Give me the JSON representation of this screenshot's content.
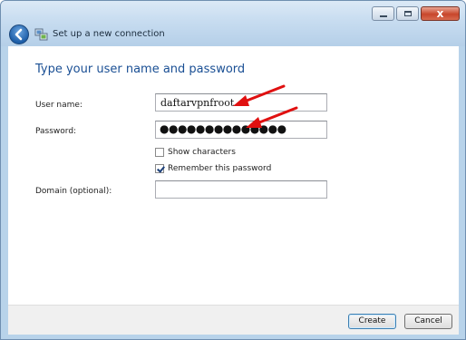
{
  "window": {
    "title": "Set up a new connection",
    "close_glyph": "x"
  },
  "main": {
    "heading": "Type your user name and password",
    "username_label": "User name:",
    "username_value": "daftarvpnfroot",
    "password_label": "Password:",
    "password_mask": "●●●●●●●●●●●●●●",
    "show_characters_label": "Show characters",
    "show_characters_checked": false,
    "remember_password_label": "Remember this password",
    "remember_password_checked": true,
    "domain_label": "Domain (optional):",
    "domain_value": ""
  },
  "footer": {
    "create_label": "Create",
    "cancel_label": "Cancel"
  },
  "colors": {
    "heading": "#1a4f94",
    "annotation_arrow": "#e01010"
  }
}
